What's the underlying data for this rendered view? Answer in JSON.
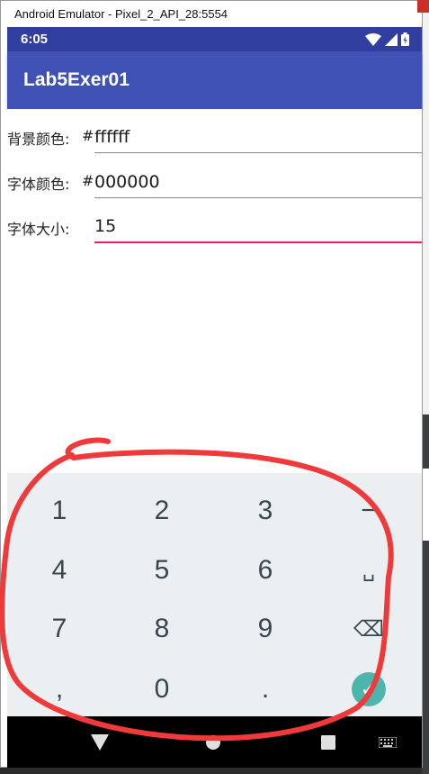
{
  "window": {
    "title": "Android Emulator - Pixel_2_API_28:5554"
  },
  "status_bar": {
    "time": "6:05"
  },
  "app_bar": {
    "title": "Lab5Exer01"
  },
  "form": {
    "rows": [
      {
        "label": "背景颜色:",
        "prefix": "#",
        "value": "ffffff"
      },
      {
        "label": "字体颜色:",
        "prefix": "#",
        "value": "000000"
      },
      {
        "label": "字体大小:",
        "prefix": "",
        "value": "15"
      }
    ]
  },
  "keypad": {
    "keys": [
      "1",
      "2",
      "3",
      "−",
      "4",
      "5",
      "6",
      "␣",
      "7",
      "8",
      "9",
      "⌫",
      ",",
      "0",
      ".",
      "✓"
    ]
  },
  "colors": {
    "status_bar": "#303f9f",
    "app_bar": "#3f51b5",
    "accent": "#e91e63",
    "keypad_bg": "#eceff1",
    "check": "#4db6ac",
    "annotation": "#ee3a3a"
  },
  "icons": {
    "status": [
      "wifi-icon",
      "signal-icon",
      "battery-icon"
    ],
    "nav": [
      "back-icon",
      "home-icon",
      "recents-icon",
      "keyboard-icon"
    ]
  }
}
